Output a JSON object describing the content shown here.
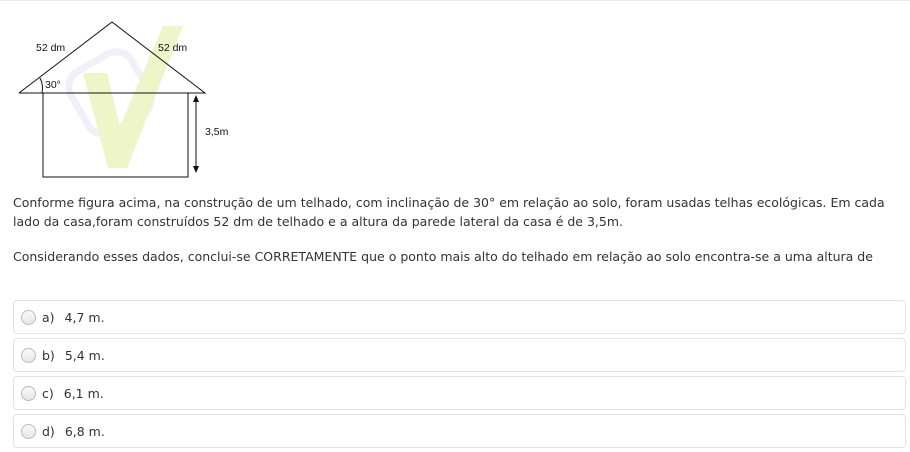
{
  "figure": {
    "left_slope_label": "52 dm",
    "right_slope_label": "52 dm",
    "angle_label": "30°",
    "wall_height_label": "3,5m",
    "colors": {
      "line": "#111111",
      "watermark_check": "#eef5c9",
      "watermark_ring": "#eef1f8"
    }
  },
  "question": {
    "paragraph_1": "Conforme figura acima, na construção de um telhado, com inclinação de 30° em relação ao solo, foram usadas telhas ecológicas. Em cada lado da casa,foram construídos 52 dm de telhado e a altura da parede lateral da casa é de 3,5m.",
    "paragraph_2": "Considerando esses dados, conclui-se CORRETAMENTE que o ponto mais alto do telhado em relação ao solo encontra-se a uma altura de"
  },
  "options": [
    {
      "letter": "a)",
      "text": "4,7 m."
    },
    {
      "letter": "b)",
      "text": "5,4 m."
    },
    {
      "letter": "c)",
      "text": "6,1 m."
    },
    {
      "letter": "d)",
      "text": "6,8 m."
    }
  ]
}
